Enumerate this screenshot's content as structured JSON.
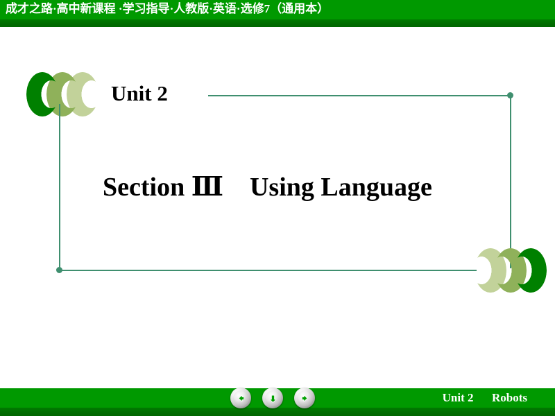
{
  "header": {
    "title": "成才之路·高中新课程 ·学习指导·人教版·英语·选修7（通用本）",
    "bar_color": "#009900",
    "text_color": "#ffffff"
  },
  "slide": {
    "unit_label": "Unit 2",
    "section_title": "Section Ⅲ　Using Language",
    "frame_color": "#3f8f6f",
    "title_color": "#000000",
    "background": "#ffffff"
  },
  "decorations": {
    "left_chevrons": {
      "icon": "triple-chevron-left-icon",
      "colors": [
        "#008000",
        "#8fb15a",
        "#c2d29a"
      ]
    },
    "right_chevrons": {
      "icon": "triple-chevron-right-icon",
      "colors": [
        "#c2d29a",
        "#8fb15a",
        "#008000"
      ]
    }
  },
  "footer": {
    "unit_label": "Unit 2",
    "unit_topic": "Robots",
    "bar_color": "#009900",
    "text_color": "#ffffff",
    "nav": [
      {
        "name": "previous-slide-button",
        "icon": "arrow-left-icon",
        "label": "Previous"
      },
      {
        "name": "down-slide-button",
        "icon": "arrow-down-icon",
        "label": "Down"
      },
      {
        "name": "next-slide-button",
        "icon": "arrow-right-icon",
        "label": "Next"
      }
    ],
    "nav_arrow_color": "#00a000"
  }
}
